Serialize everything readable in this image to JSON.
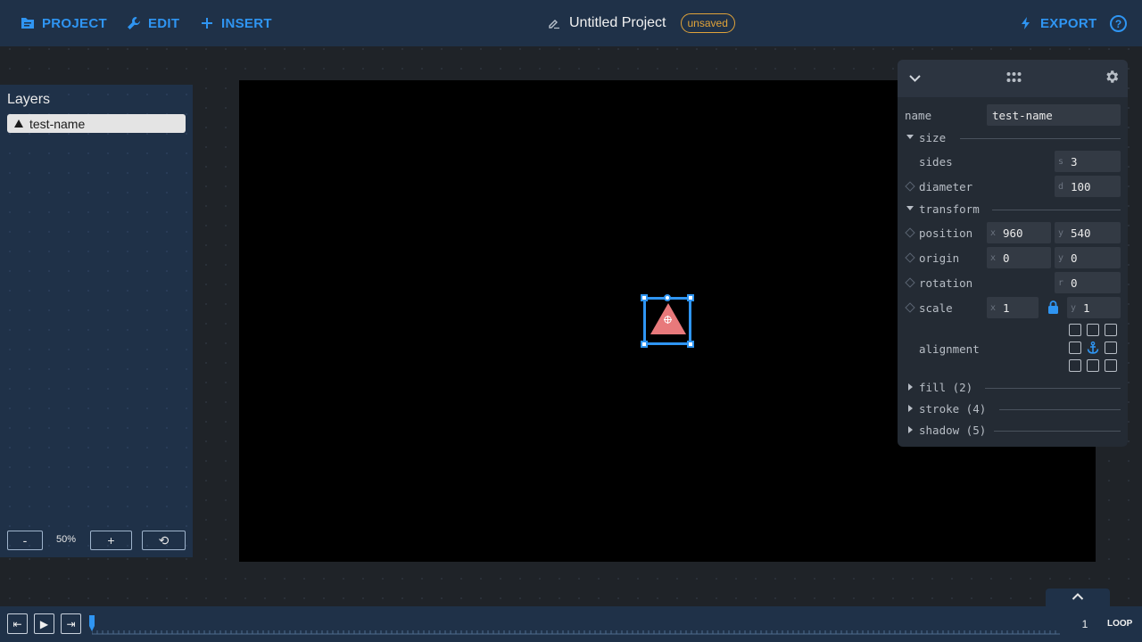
{
  "topbar": {
    "project_label": "PROJECT",
    "edit_label": "EDIT",
    "insert_label": "INSERT",
    "title": "Untitled Project",
    "status": "unsaved",
    "export_label": "EXPORT",
    "help_label": "?"
  },
  "layers": {
    "title": "Layers",
    "items": [
      {
        "name": "test-name",
        "icon": "triangle-icon"
      }
    ],
    "zoom_out_label": "-",
    "zoom_level": "50%",
    "zoom_in_label": "+",
    "zoom_reset_label": "⟲"
  },
  "canvas": {
    "background": "#000000",
    "shape": {
      "type": "triangle",
      "fill": "#e8797b",
      "selected": true
    }
  },
  "inspector": {
    "name_label": "name",
    "name_value": "test-name",
    "size": {
      "title": "size",
      "sides_label": "sides",
      "sides_prefix": "s",
      "sides_value": "3",
      "diameter_label": "diameter",
      "diameter_prefix": "d",
      "diameter_value": "100"
    },
    "transform": {
      "title": "transform",
      "position_label": "position",
      "position_x": "960",
      "position_y": "540",
      "origin_label": "origin",
      "origin_x": "0",
      "origin_y": "0",
      "rotation_label": "rotation",
      "rotation_prefix": "r",
      "rotation_value": "0",
      "scale_label": "scale",
      "scale_x": "1",
      "scale_y": "1",
      "x_prefix": "x",
      "y_prefix": "y",
      "alignment_label": "alignment"
    },
    "fill_title": "fill (2)",
    "stroke_title": "stroke (4)",
    "shadow_title": "shadow (5)"
  },
  "timeline": {
    "start_label": "⇤",
    "play_label": "▶",
    "end_label": "⇥",
    "frame": "1",
    "loop_label": "LOOP"
  },
  "colors": {
    "accent": "#2f95f2",
    "topbar": "#1f3148",
    "badge": "#e0a33a"
  }
}
